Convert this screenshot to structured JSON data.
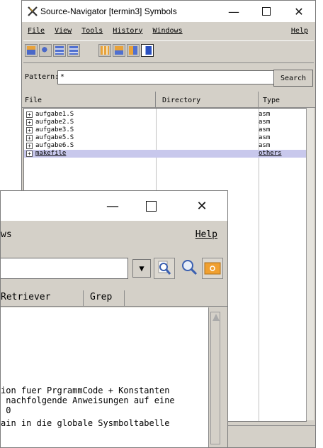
{
  "back_window": {
    "title": "Source-Navigator [termin3] Symbols",
    "menu": [
      "File",
      "View",
      "Tools",
      "History",
      "Windows"
    ],
    "menu_help": "Help",
    "pattern_label": "Pattern:",
    "pattern_value": "*",
    "search_label": "Search",
    "columns": {
      "file": "File",
      "directory": "Directory",
      "type": "Type"
    },
    "rows": [
      {
        "file": "aufgabe1.S",
        "type": "asm"
      },
      {
        "file": "aufgabe2.S",
        "type": "asm"
      },
      {
        "file": "aufgabe3.S",
        "type": "asm"
      },
      {
        "file": "aufgabe5.S",
        "type": "asm"
      },
      {
        "file": "aufgabe6.S",
        "type": "asm"
      },
      {
        "file": "makefile",
        "type": "others",
        "selected": true
      }
    ]
  },
  "front_window": {
    "menu_partial": "ws",
    "menu_help": "Help",
    "tabs": [
      "Retriever",
      "Grep"
    ],
    "code_lines": [
      "ion fuer PrgrammCode + Konstanten",
      " nachfolgende Anweisungen auf eine",
      " 0",
      "ain in die globale Sysmboltabelle"
    ]
  }
}
